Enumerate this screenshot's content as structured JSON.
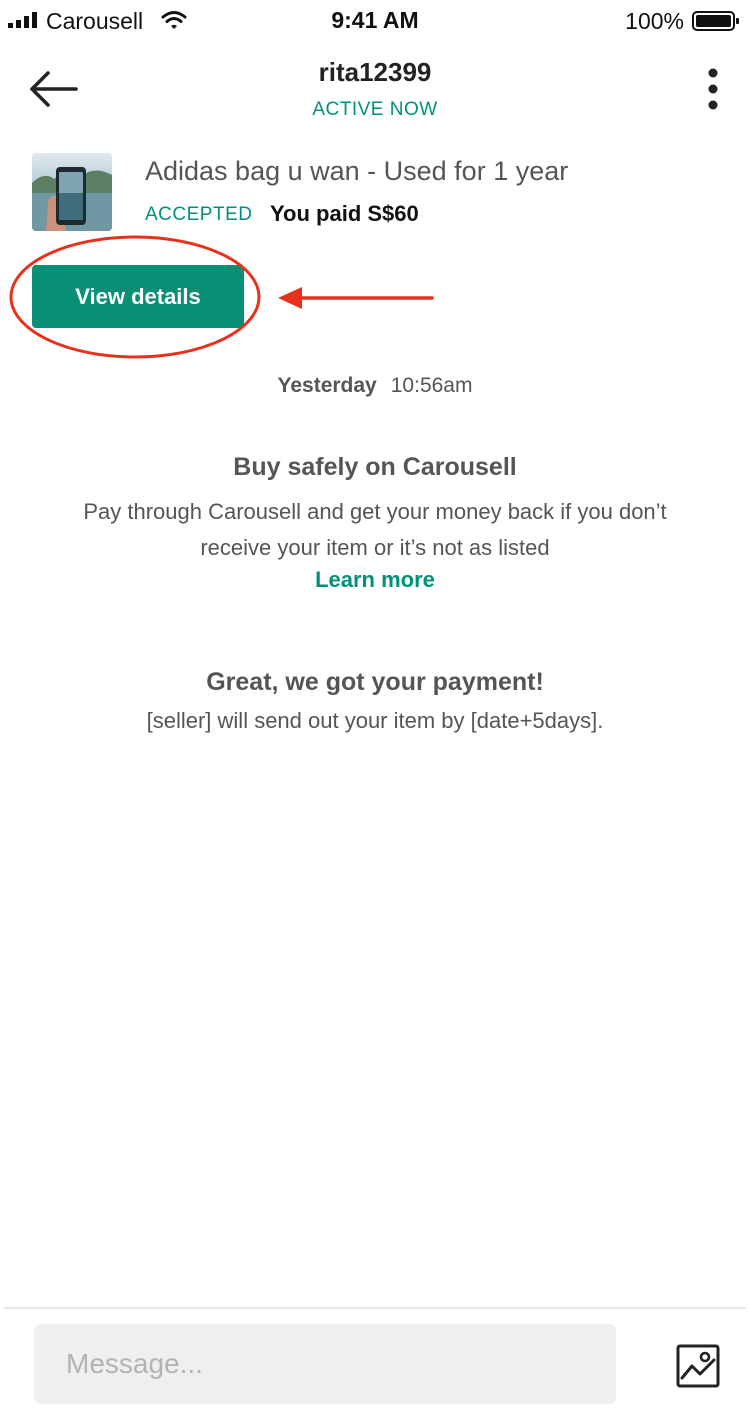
{
  "status_bar": {
    "carrier": "Carousell",
    "time": "9:41 AM",
    "battery": "100%"
  },
  "header": {
    "username": "rita12399",
    "status": "ACTIVE NOW",
    "back_icon": "arrow-left-icon",
    "more_icon": "more-vertical-icon"
  },
  "listing": {
    "title": "Adidas bag u wan - Used for 1 year",
    "offer_status": "ACCEPTED",
    "paid_text": "You paid S$60",
    "thumbnail": "phone-photo-thumbnail"
  },
  "actions": {
    "view_details": "View details"
  },
  "messages": {
    "day": "Yesterday",
    "time": "10:56am",
    "safety_title": "Buy safely on Carousell",
    "safety_body": "Pay through Carousell and get your money back if you don’t receive your item or it’s not as listed",
    "learn_more": "Learn more",
    "payment_title": "Great, we got your payment!",
    "payment_body": "[seller] will send out your item by [date+5days]."
  },
  "composer": {
    "placeholder": "Message...",
    "photo_icon": "image-icon"
  },
  "colors": {
    "accent": "#0a8f77",
    "accent_text": "#00917a",
    "annotation": "#e8301c"
  }
}
